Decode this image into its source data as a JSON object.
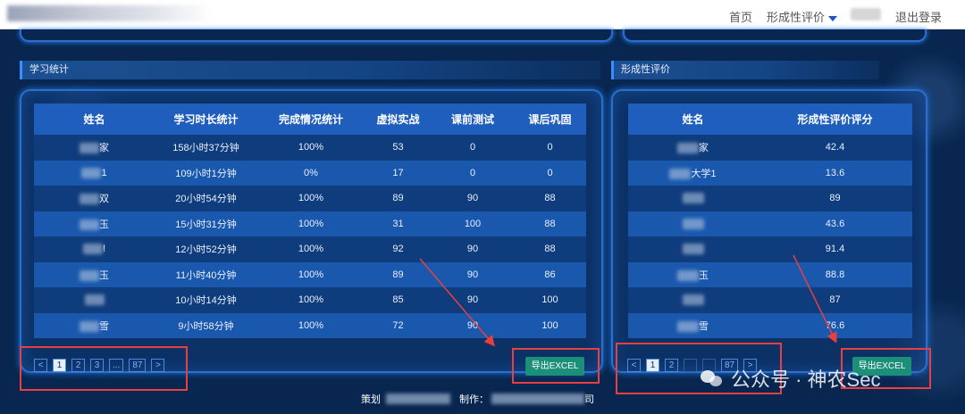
{
  "header": {
    "site_title": "",
    "nav_home": "首页",
    "nav_eval": "形成性评价",
    "nav_logout": "退出登录"
  },
  "sections": {
    "left_title": "学习统计",
    "right_title": "形成性评价"
  },
  "study_table": {
    "columns": [
      "姓名",
      "学习时长统计",
      "完成情况统计",
      "虚拟实战",
      "课前测试",
      "课后巩固"
    ],
    "rows": [
      {
        "name_suffix": "家",
        "duration": "158小时37分钟",
        "completion": "100%",
        "virtual": "53",
        "pre_test": "0",
        "post": "0"
      },
      {
        "name_suffix": "1",
        "duration": "109小时1分钟",
        "completion": "0%",
        "virtual": "17",
        "pre_test": "0",
        "post": "0"
      },
      {
        "name_suffix": "双",
        "duration": "20小时54分钟",
        "completion": "100%",
        "virtual": "89",
        "pre_test": "90",
        "post": "88"
      },
      {
        "name_suffix": "玉",
        "duration": "15小时31分钟",
        "completion": "100%",
        "virtual": "31",
        "pre_test": "100",
        "post": "88"
      },
      {
        "name_suffix": "!",
        "duration": "12小时52分钟",
        "completion": "100%",
        "virtual": "92",
        "pre_test": "90",
        "post": "88"
      },
      {
        "name_suffix": "玉",
        "duration": "11小时40分钟",
        "completion": "100%",
        "virtual": "89",
        "pre_test": "90",
        "post": "86"
      },
      {
        "name_suffix": "",
        "duration": "10小时14分钟",
        "completion": "100%",
        "virtual": "85",
        "pre_test": "90",
        "post": "100"
      },
      {
        "name_suffix": "雪",
        "duration": "9小时58分钟",
        "completion": "100%",
        "virtual": "72",
        "pre_test": "90",
        "post": "100"
      }
    ]
  },
  "eval_table": {
    "columns": [
      "姓名",
      "形成性评价评分"
    ],
    "rows": [
      {
        "name_suffix": "家",
        "score": "42.4"
      },
      {
        "name_suffix": "大学1",
        "score": "13.6"
      },
      {
        "name_suffix": "",
        "score": "89"
      },
      {
        "name_suffix": "",
        "score": "43.6"
      },
      {
        "name_suffix": "",
        "score": "91.4"
      },
      {
        "name_suffix": "玉",
        "score": "88.8"
      },
      {
        "name_suffix": "",
        "score": "87"
      },
      {
        "name_suffix": "雪",
        "score": "76.6"
      }
    ]
  },
  "pagination_left": {
    "prev": "<",
    "pages": [
      "1",
      "2",
      "3",
      "...",
      "87"
    ],
    "next": ">"
  },
  "pagination_right": {
    "prev": "<",
    "pages": [
      "1",
      "2",
      "",
      "",
      "87"
    ],
    "next": ">"
  },
  "buttons": {
    "export_excel": "导出EXCEL"
  },
  "footer": {
    "planner_label": "策划",
    "maker_label": "制作：",
    "maker_tail": "司"
  },
  "watermark": {
    "text": "公众号 · 神农Sec"
  },
  "colors": {
    "background": "#08264f",
    "table_header": "#1f5ebd",
    "row_dark": "#0f3c7c",
    "row_light": "#1a58ad",
    "export_button": "#1b8f78",
    "annotation": "#e84040"
  }
}
